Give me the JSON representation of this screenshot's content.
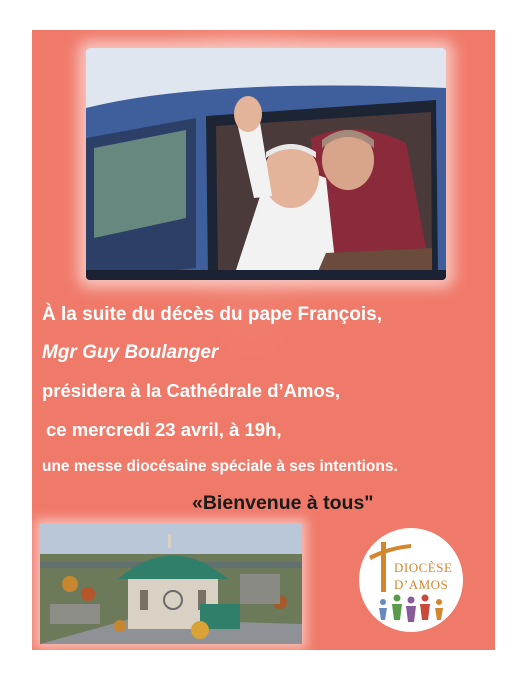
{
  "announcement": {
    "line1": "À la suite du décès du pape François,",
    "line2": "Mgr Guy Boulanger",
    "line3": "présidera à la Cathédrale d’Amos,",
    "line4": "ce mercredi 23 avril, à 19h,",
    "line5": "une messe diocésaine spéciale à ses intentions.",
    "welcome": "«Bienvenue à tous\""
  },
  "logo": {
    "line1": "DIOCÈSE",
    "line2": "D’AMOS"
  },
  "colors": {
    "background": "#f07a6a",
    "text": "#ffffff",
    "welcome_text": "#1a1a1a",
    "logo_accent": "#d4862e"
  }
}
